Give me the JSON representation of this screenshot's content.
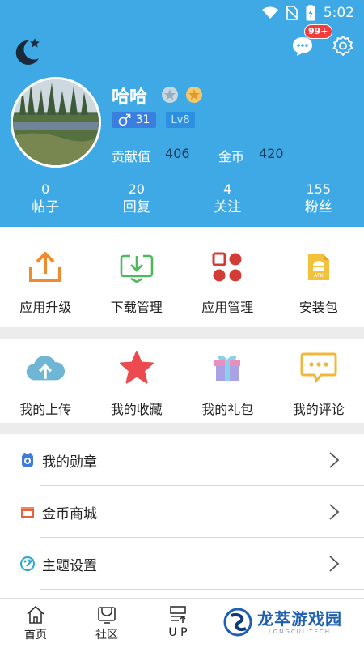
{
  "status_bar": {
    "time": "5:02"
  },
  "header": {
    "notification_badge": "99+",
    "username": "哈哈",
    "gender_value": "31",
    "level": "Lv8",
    "contribution_label": "贡献值",
    "contribution_value": "406",
    "coins_label": "金币",
    "coins_value": "420"
  },
  "stats": [
    {
      "value": "0",
      "label": "帖子"
    },
    {
      "value": "20",
      "label": "回复"
    },
    {
      "value": "4",
      "label": "关注"
    },
    {
      "value": "155",
      "label": "粉丝"
    }
  ],
  "grid1": [
    {
      "label": "应用升级",
      "icon": "upload-tray-icon"
    },
    {
      "label": "下载管理",
      "icon": "download-tray-icon"
    },
    {
      "label": "应用管理",
      "icon": "apps-grid-icon"
    },
    {
      "label": "安装包",
      "icon": "apk-file-icon"
    }
  ],
  "grid2": [
    {
      "label": "我的上传",
      "icon": "cloud-upload-icon"
    },
    {
      "label": "我的收藏",
      "icon": "star-icon"
    },
    {
      "label": "我的礼包",
      "icon": "gift-icon"
    },
    {
      "label": "我的评论",
      "icon": "comment-icon"
    }
  ],
  "list": [
    {
      "label": "我的勋章",
      "icon": "medal-icon"
    },
    {
      "label": "金币商城",
      "icon": "shop-icon"
    },
    {
      "label": "主题设置",
      "icon": "palette-icon"
    }
  ],
  "tabbar": [
    {
      "label": "首页",
      "icon": "home-icon"
    },
    {
      "label": "社区",
      "icon": "community-icon"
    },
    {
      "label": "U P",
      "icon": "up-icon"
    }
  ],
  "watermark": {
    "name": "龙萃游戏园",
    "sub": "LONGCUI TECH"
  },
  "colors": {
    "header_bg": "#3fa9e6",
    "badge_red": "#f23b3b",
    "level_blue": "#2d8fe0"
  }
}
